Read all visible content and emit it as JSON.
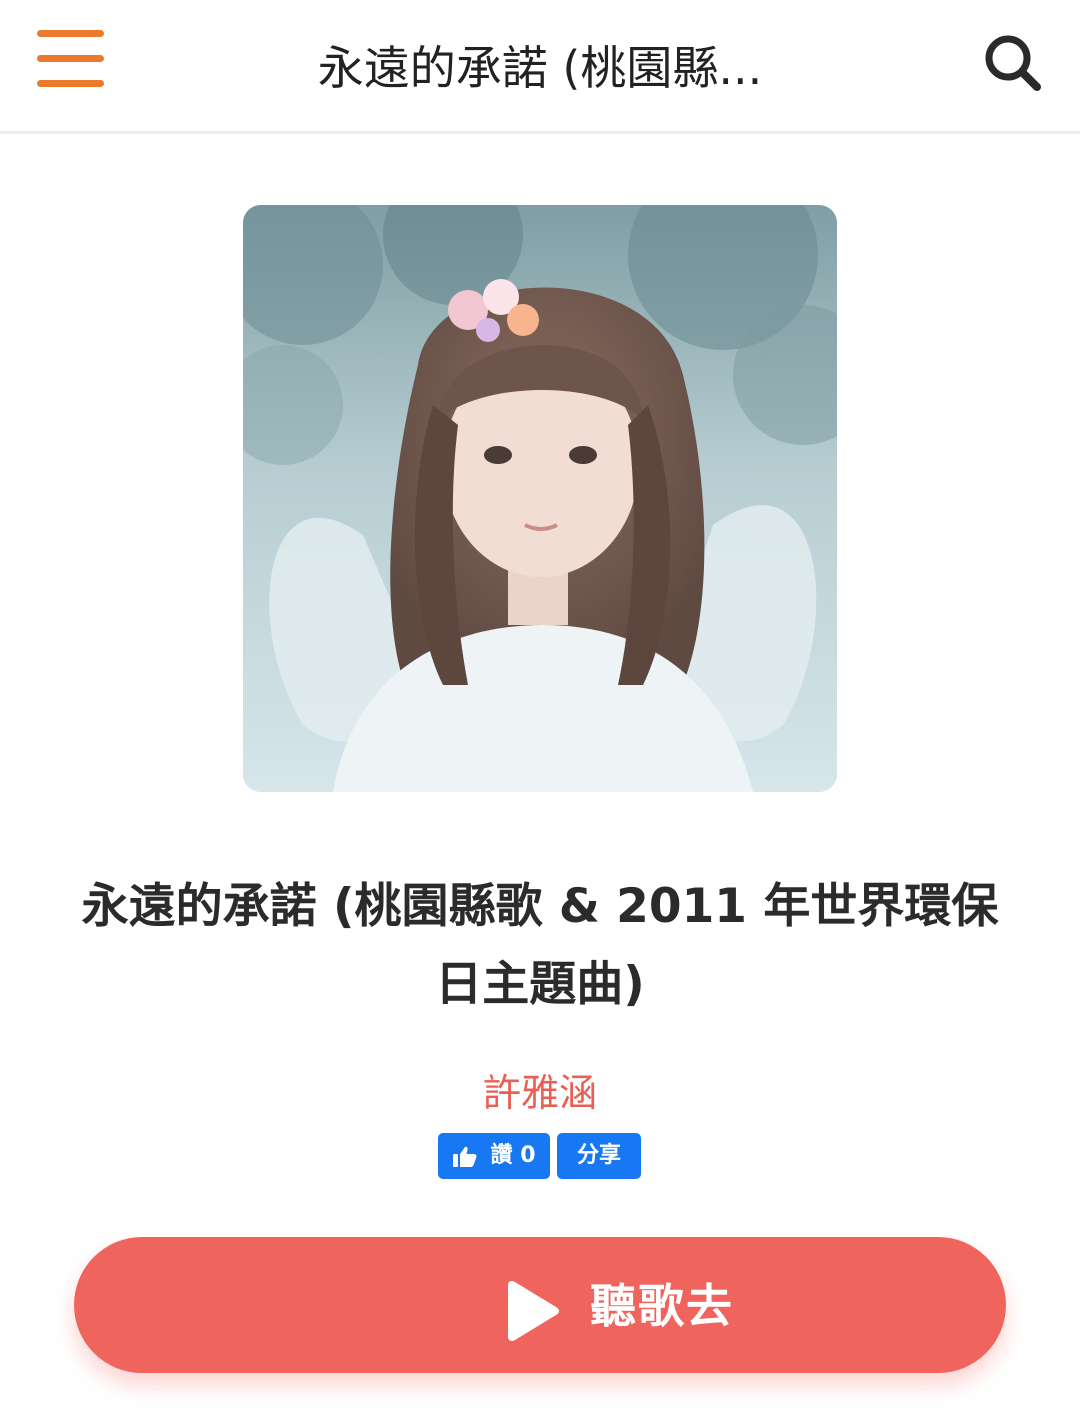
{
  "header": {
    "title": "永遠的承諾 (桃園縣...",
    "menu_icon": "hamburger-menu-icon",
    "search_icon": "search-icon",
    "accent_color": "#ec7a2c"
  },
  "album": {
    "cover_alt": "album-cover"
  },
  "song": {
    "title": "永遠的承諾 (桃園縣歌 & 2011 年世界環保日主題曲)",
    "artist": "許雅涵",
    "artist_color": "#ea5f53"
  },
  "social": {
    "like_label": "讚",
    "like_count": "0",
    "share_label": "分享",
    "button_color": "#1877f2",
    "like_icon": "thumbs-up-icon"
  },
  "play": {
    "label": "聽歌去",
    "icon": "play-icon",
    "button_color": "#ef645d"
  }
}
